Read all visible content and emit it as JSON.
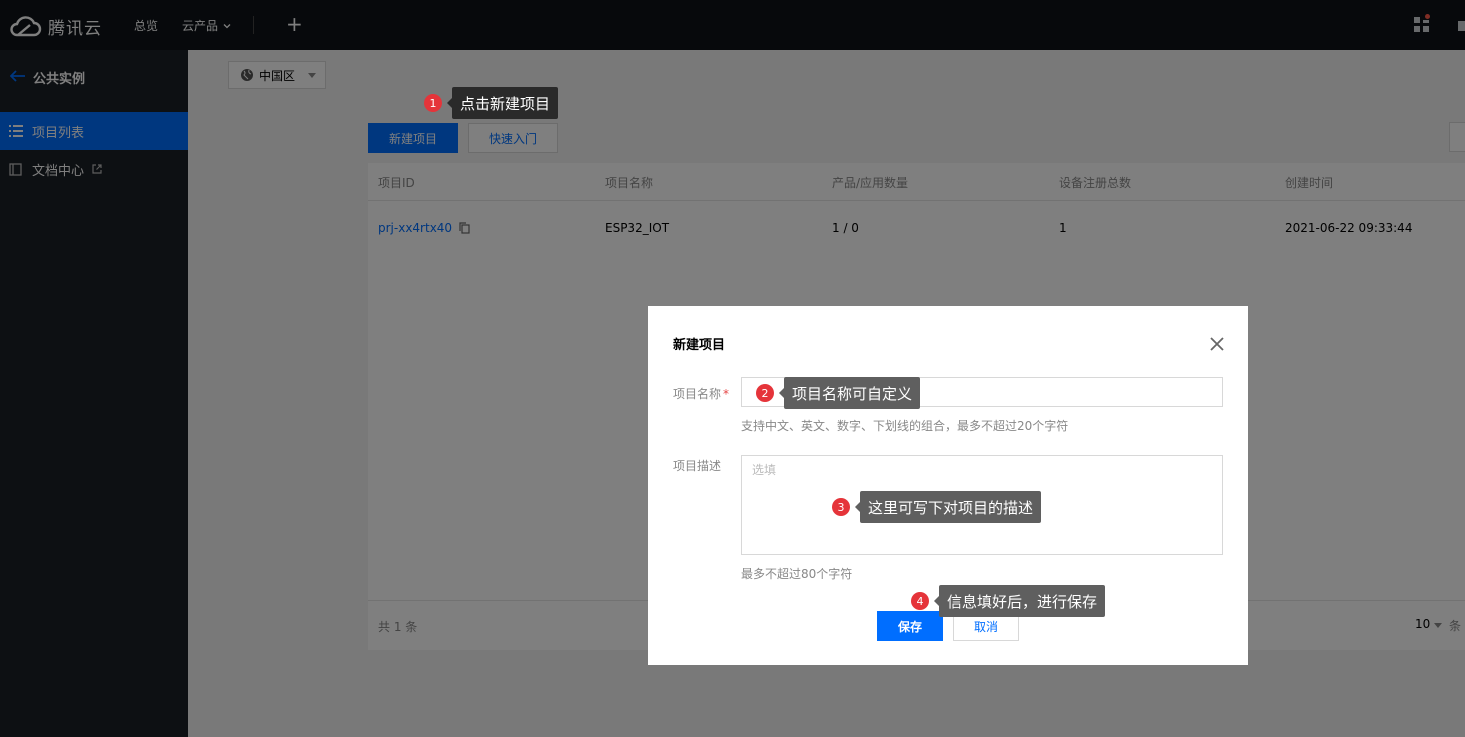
{
  "topbar": {
    "brand": "腾讯云",
    "nav": {
      "overview": "总览",
      "products": "云产品"
    },
    "plus": "+"
  },
  "sidebar": {
    "back_label": "公共实例",
    "items": [
      {
        "label": "项目列表",
        "icon": "list-icon",
        "active": true
      },
      {
        "label": "文档中心",
        "icon": "doc-icon",
        "external": true
      }
    ]
  },
  "main": {
    "region": "中国区",
    "buttons": {
      "new_project": "新建项目",
      "quickstart": "快速入门"
    },
    "table": {
      "headers": [
        "项目ID",
        "项目名称",
        "产品/应用数量",
        "设备注册总数",
        "创建时间"
      ],
      "rows": [
        {
          "id": "prj-xx4rtx40",
          "name": "ESP32_IOT",
          "product_count": "1 / 0",
          "device_count": "1",
          "created": "2021-06-22 09:33:44"
        }
      ]
    },
    "footer": {
      "total": "共 1 条",
      "page_size": "10",
      "page_unit": "条"
    }
  },
  "dialog": {
    "title": "新建项目",
    "name_label": "项目名称",
    "required_mark": "*",
    "name_value": "",
    "name_help": "支持中文、英文、数字、下划线的组合，最多不超过20个字符",
    "desc_label": "项目描述",
    "desc_placeholder": "选填",
    "desc_help": "最多不超过80个字符",
    "save": "保存",
    "cancel": "取消"
  },
  "annotations": [
    {
      "number": "1",
      "text": "点击新建项目"
    },
    {
      "number": "2",
      "text": "项目名称可自定义"
    },
    {
      "number": "3",
      "text": "这里可写下对项目的描述"
    },
    {
      "number": "4",
      "text": "信息填好后，进行保存"
    }
  ],
  "colors": {
    "primary": "#006eff",
    "topbar_bg": "#0e1318",
    "sidebar_bg": "#1b2026",
    "badge": "#e5343a",
    "callout_bg": "#5f5f5f"
  }
}
